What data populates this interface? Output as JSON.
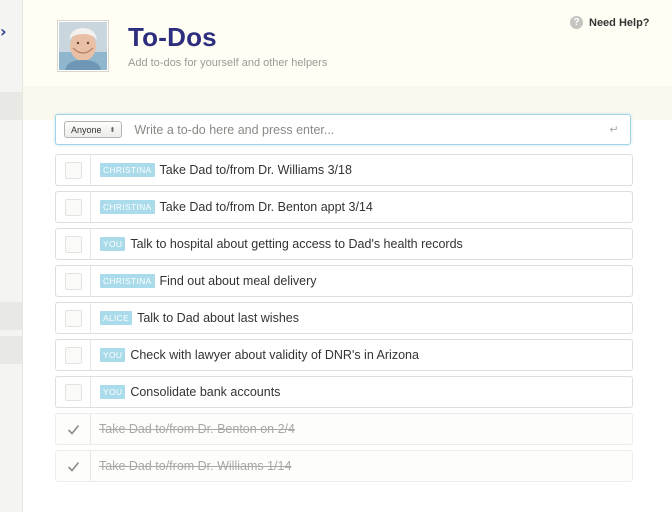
{
  "header": {
    "title": "To-Dos",
    "subtitle": "Add to-dos for yourself and other helpers",
    "help_label": "Need Help?",
    "help_icon": "question-circle-icon"
  },
  "composer": {
    "assignee": "Anyone",
    "placeholder": "Write a to-do here and press enter..."
  },
  "colors": {
    "title": "#2e2e7e",
    "tag_bg": "#a9dbea",
    "composer_border": "#9fd4e6"
  },
  "todos": [
    {
      "assignee": "CHRISTINA",
      "text": "Take Dad to/from Dr. Williams 3/18",
      "done": false
    },
    {
      "assignee": "CHRISTINA",
      "text": "Take Dad to/from Dr. Benton appt 3/14",
      "done": false
    },
    {
      "assignee": "YOU",
      "text": "Talk to hospital about getting access to Dad's health records",
      "done": false
    },
    {
      "assignee": "CHRISTINA",
      "text": "Find out about meal delivery",
      "done": false
    },
    {
      "assignee": "ALICE",
      "text": "Talk to Dad about last wishes",
      "done": false
    },
    {
      "assignee": "YOU",
      "text": "Check with lawyer about validity of DNR's in Arizona",
      "done": false
    },
    {
      "assignee": "YOU",
      "text": "Consolidate bank accounts",
      "done": false
    },
    {
      "assignee": "",
      "text": "Take Dad to/from Dr. Benton on 2/4",
      "done": true
    },
    {
      "assignee": "",
      "text": "Take Dad to/from Dr. Williams 1/14",
      "done": true
    }
  ]
}
